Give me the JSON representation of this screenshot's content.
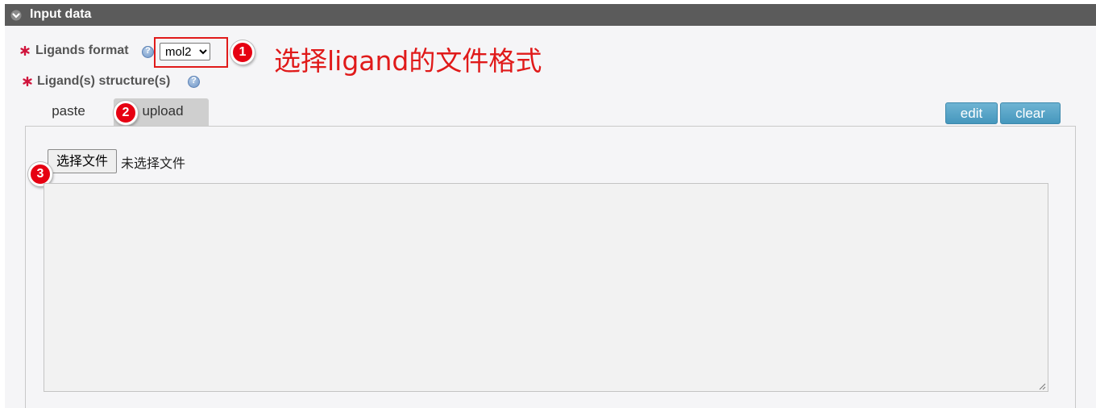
{
  "panel": {
    "title": "Input data",
    "header_color": "#5b5b5b"
  },
  "ligands_format": {
    "label": "Ligands format",
    "selected": "mol2",
    "options": [
      "mol2"
    ]
  },
  "ligand_structures": {
    "label": "Ligand(s) structure(s)"
  },
  "tabs": [
    {
      "label": "paste",
      "active": false
    },
    {
      "label": "upload",
      "active": true
    }
  ],
  "buttons": {
    "edit": "edit",
    "clear": "clear"
  },
  "file_input": {
    "button_label": "选择文件",
    "status": "未选择文件"
  },
  "annotations": {
    "step1": "1",
    "step2": "2",
    "step3": "3",
    "step1_text": "选择ligand的文件格式",
    "color": "#e01a1a"
  },
  "icons": {
    "required": "asterisk-icon",
    "help": "help-icon",
    "collapse": "chevron-down-icon"
  }
}
